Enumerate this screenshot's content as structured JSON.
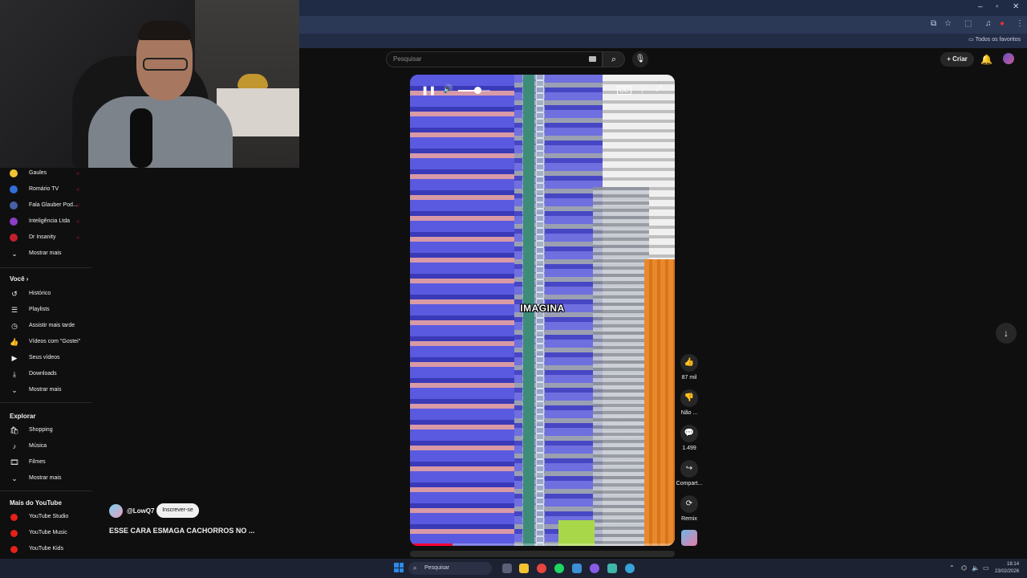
{
  "browser": {
    "window_controls": [
      "–",
      "▫",
      "✕"
    ],
    "bookmark_label": "Todos os favoritos"
  },
  "header": {
    "search_placeholder": "Pesquisar",
    "create_label": "Criar"
  },
  "sidebar": {
    "subscriptions": [
      {
        "label": "Gaules",
        "color": "#f2c230"
      },
      {
        "label": "Romário TV",
        "color": "#2f6fd6"
      },
      {
        "label": "Fala Glauber Pod...",
        "color": "#4a5fa8"
      },
      {
        "label": "Inteligência Ltda",
        "color": "#8a3fc4"
      },
      {
        "label": "Dr Insanity",
        "color": "#c2202c"
      }
    ],
    "subs_more": "Mostrar mais",
    "you_heading": "Você",
    "you_items": [
      {
        "label": "Histórico",
        "icon": "history-icon",
        "glyph": "↺"
      },
      {
        "label": "Playlists",
        "icon": "playlist-icon",
        "glyph": "☰"
      },
      {
        "label": "Assistir mais tarde",
        "icon": "clock-icon",
        "glyph": "◷"
      },
      {
        "label": "Vídeos com \"Gostei\"",
        "icon": "thumbs-up-icon",
        "glyph": "👍"
      },
      {
        "label": "Seus vídeos",
        "icon": "video-icon",
        "glyph": "▶"
      },
      {
        "label": "Downloads",
        "icon": "download-icon",
        "glyph": "⤓"
      }
    ],
    "you_more": "Mostrar mais",
    "explore_heading": "Explorar",
    "explore_items": [
      {
        "label": "Shopping",
        "icon": "shopping-bag-icon",
        "glyph": "🛍"
      },
      {
        "label": "Música",
        "icon": "music-note-icon",
        "glyph": "♪"
      },
      {
        "label": "Filmes",
        "icon": "film-icon",
        "glyph": "🎞"
      }
    ],
    "explore_more": "Mostrar mais",
    "more_heading": "Mais do YouTube",
    "more_items": [
      {
        "label": "YouTube Studio"
      },
      {
        "label": "YouTube Music"
      },
      {
        "label": "YouTube Kids"
      }
    ]
  },
  "video": {
    "caption": "IMAGINA",
    "volume_fraction": 0.6,
    "progress_fraction": 0.16
  },
  "actions": {
    "like_count": "87 mil",
    "dislike_label": "Não ...",
    "comments_count": "1.499",
    "share_label": "Compart...",
    "remix_label": "Remix"
  },
  "channel": {
    "handle": "@LowQ7",
    "subscribe_label": "Inscrever-se",
    "video_title": "ESSE CARA ESMAGA CACHORROS NO ..."
  },
  "taskbar": {
    "search_label": "Pesquisar",
    "time": "18:14",
    "date": "23/02/2026"
  }
}
